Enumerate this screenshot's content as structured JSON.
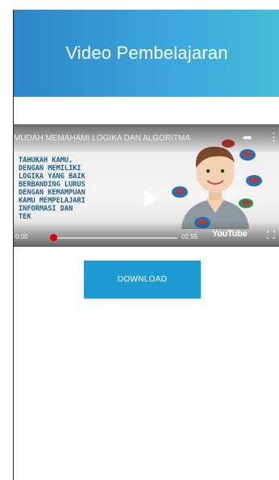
{
  "header": {
    "title": "Video Pembelajaran"
  },
  "video": {
    "title": "MUDAH MEMAHAMI LOGIKA DAN ALGORITMA",
    "slide_lines": [
      "TAHUKAH KAMU,",
      "DENGAN MEMILIKI",
      "LOGIKA YANG BAIK",
      "BERBANDING LURUS",
      "DENGAN KEMAMPUAN",
      "KAMU MEMPELAJARI",
      "INFORMASI DAN",
      "TEK"
    ],
    "current_time": "0:00",
    "total_time": "02.55",
    "player_brand": "YouTube",
    "progress_fraction": 0.0
  },
  "actions": {
    "download_label": "DOWNLOAD"
  },
  "colors": {
    "header_start": "#2b86c9",
    "header_end": "#43bdd8",
    "button": "#1e9bd3",
    "progress": "#e00000"
  }
}
